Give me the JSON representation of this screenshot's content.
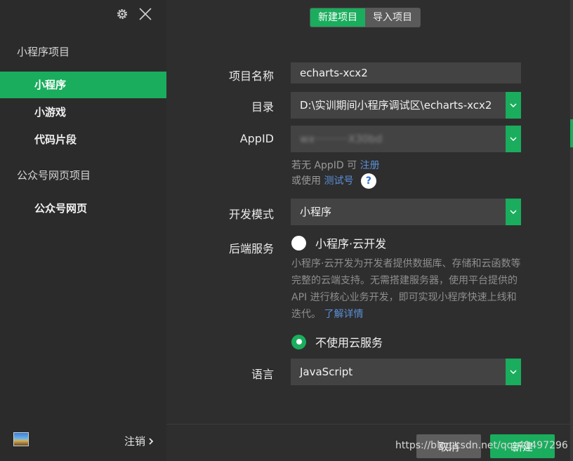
{
  "sidebar": {
    "section_miniprogram": "小程序项目",
    "items": [
      {
        "label": "小程序"
      },
      {
        "label": "小游戏"
      },
      {
        "label": "代码片段"
      }
    ],
    "section_official": "公众号网页项目",
    "official_items": [
      {
        "label": "公众号网页"
      }
    ],
    "logout_label": "注销",
    "icons": {
      "settings": "gear-icon",
      "close": "close-icon",
      "logout_arrow": "chevron-right-icon"
    }
  },
  "tabs": {
    "new_project": "新建项目",
    "import_project": "导入项目"
  },
  "form": {
    "name_label": "项目名称",
    "name_value": "echarts-xcx2",
    "dir_label": "目录",
    "dir_value": "D:\\实训期间小程序调试区\\echarts-xcx2",
    "appid_label": "AppID",
    "appid_value": "wx··········X30bd",
    "appid_hint_prefix": "若无 AppID 可",
    "appid_hint_register": "注册",
    "appid_hint2_prefix": "或使用",
    "appid_hint2_test": "测试号",
    "help_icon": "?",
    "mode_label": "开发模式",
    "mode_value": "小程序",
    "backend_label": "后端服务",
    "cloud_option": "小程序·云开发",
    "cloud_desc": "小程序·云开发为开发者提供数据库、存储和云函数等完整的云端支持。无需搭建服务器，使用平台提供的 API 进行核心业务开发，即可实现小程序快速上线和迭代。",
    "cloud_more": "了解详情",
    "no_cloud_option": "不使用云服务",
    "lang_label": "语言",
    "lang_value": "JavaScript"
  },
  "footer": {
    "cancel": "取消",
    "create": "新建"
  },
  "watermark": "https://blog.csdn.net/qq_41497296",
  "colors": {
    "accent": "#1aad5d",
    "link": "#5b8fd6",
    "sidebar_bg": "#2b2b2b",
    "main_bg": "#2e2e2e"
  }
}
